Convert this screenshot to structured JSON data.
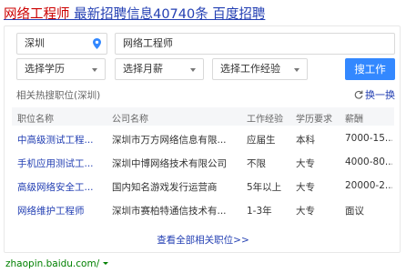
{
  "header": {
    "title_highlight": "网络工程师",
    "title_rest": " 最新招聘信息40740条 百度招聘"
  },
  "search": {
    "city": "深圳",
    "keyword": "网络工程师",
    "education": "选择学历",
    "salary": "选择月薪",
    "experience": "选择工作经验",
    "button": "搜工作"
  },
  "related": {
    "title": "相关热搜职位(深圳)",
    "refresh": "换一换",
    "columns": [
      "职位名称",
      "公司名称",
      "工作经验",
      "学历要求",
      "薪酬"
    ],
    "rows": [
      [
        "中高级测试工程...",
        "深圳市万方网络信息有限...",
        "应届生",
        "本科",
        "7000-15..."
      ],
      [
        "手机应用测试工...",
        "深圳中博网络技术有限公司",
        "不限",
        "大专",
        "4000-80..."
      ],
      [
        "高级网络安全工...",
        "国内知名游戏发行运营商",
        "5年以上",
        "大专",
        "20000-2..."
      ],
      [
        "网络维护工程师",
        "深圳市赛柏特通信技术有...",
        "1-3年",
        "大专",
        "面议"
      ]
    ],
    "more": "查看全部相关职位>>"
  },
  "footer": {
    "url": "zhaopin.baidu.com/"
  },
  "colors": {
    "link": "#2440b3",
    "highlight": "#cc0000",
    "button": "#3388ff",
    "url": "#008000"
  },
  "icons": [
    "location-pin-icon",
    "chevron-down-icon",
    "refresh-icon"
  ]
}
